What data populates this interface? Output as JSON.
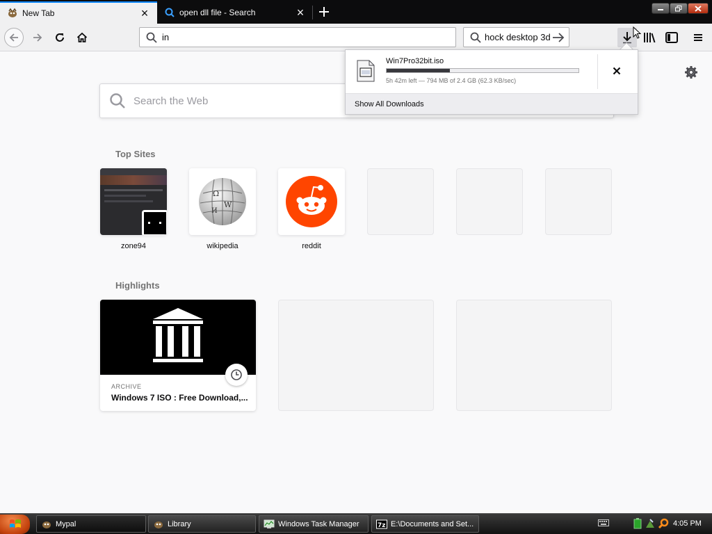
{
  "tabs": [
    {
      "label": "New Tab",
      "active": true,
      "icon": "mypal-icon"
    },
    {
      "label": "open dll file - Search",
      "active": false,
      "icon": "search-icon"
    }
  ],
  "navbar": {
    "url_value": "in",
    "search_value": "hock desktop 3d",
    "icons": [
      "back-icon",
      "forward-icon",
      "reload-icon",
      "home-icon",
      "downloads-icon",
      "library-icon",
      "sidebar-icon",
      "menu-icon"
    ]
  },
  "newtab": {
    "search_placeholder": "Search the Web",
    "top_sites_title": "Top Sites",
    "top_sites": [
      {
        "label": "zone94"
      },
      {
        "label": "wikipedia"
      },
      {
        "label": "reddit"
      }
    ],
    "highlights_title": "Highlights",
    "highlights": [
      {
        "source": "ARCHIVE",
        "title": "Windows 7 ISO : Free Download,..."
      }
    ]
  },
  "downloads": {
    "filename": "Win7Pro32bit.iso",
    "status": "5h 42m left — 794 MB of 2.4 GB (62.3 KB/sec)",
    "progress_fraction": 0.33,
    "show_all_label": "Show All Downloads"
  },
  "taskbar": {
    "items": [
      {
        "label": "Mypal"
      },
      {
        "label": "Library"
      },
      {
        "label": "Windows Task Manager"
      },
      {
        "label": "E:\\Documents and Set..."
      }
    ],
    "clock": "4:05 PM"
  },
  "colors": {
    "accent": "#0a84ff",
    "reddit": "#ff4500",
    "tabbar": "#0c0c0d"
  }
}
